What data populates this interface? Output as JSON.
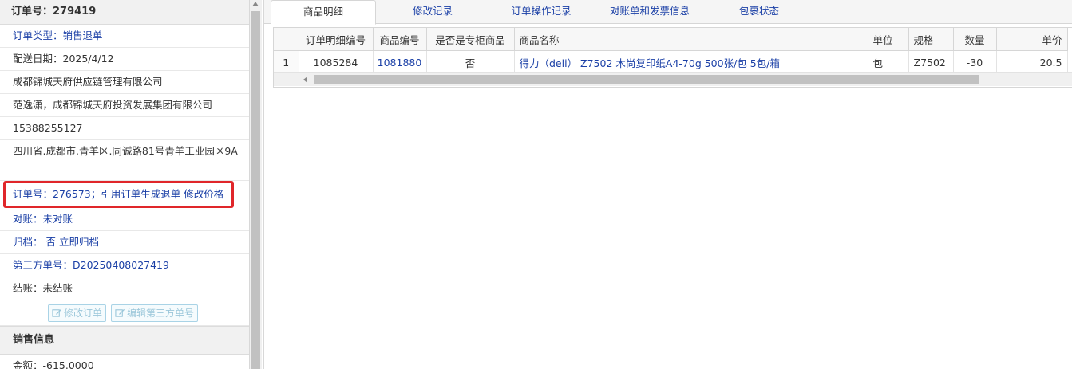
{
  "order_panel": {
    "title": "订单号：279419",
    "order_type": "订单类型：销售退单",
    "delivery_date": "配送日期：2025/4/12",
    "company": "成都锦城天府供应链管理有限公司",
    "contact": "范逸潇，成都锦城天府投资发展集团有限公司",
    "phone": "15388255127",
    "address": "四川省.成都市.青羊区.同诚路81号青羊工业园区9A",
    "order_ref_text": "订单号：276573；引用订单生成退单",
    "modify_price_link": "修改价格",
    "reconcile": "对账：未对账",
    "archive_text": "归档：  否",
    "archive_link": "立即归档",
    "third_party_no": "第三方单号：D20250408027419",
    "settlement": "结账：未结账",
    "edit_order_btn": "修改订单",
    "edit_third_btn": "编辑第三方单号",
    "sales_section": "销售信息",
    "amount": "金额：-615.0000"
  },
  "tabs": [
    {
      "label": "商品明细",
      "active": true
    },
    {
      "label": "修改记录",
      "active": false
    },
    {
      "label": "订单操作记录",
      "active": false
    },
    {
      "label": "对账单和发票信息",
      "active": false
    },
    {
      "label": "包裹状态",
      "active": false
    }
  ],
  "grid": {
    "headers": [
      "",
      "订单明细编号",
      "商品编号",
      "是否是专柜商品",
      "商品名称",
      "单位",
      "规格",
      "数量",
      "单价"
    ],
    "rows": [
      [
        "1",
        "1085284",
        "1081880",
        "否",
        "得力（deli） Z7502 木尚复印纸A4-70g 500张/包 5包/箱",
        "包",
        "Z7502",
        "-30",
        "20.5"
      ]
    ]
  },
  "colors": {
    "link": "#1a3fa6",
    "highlight_border": "#e0262a",
    "header_bg": "#f1f1f1"
  }
}
